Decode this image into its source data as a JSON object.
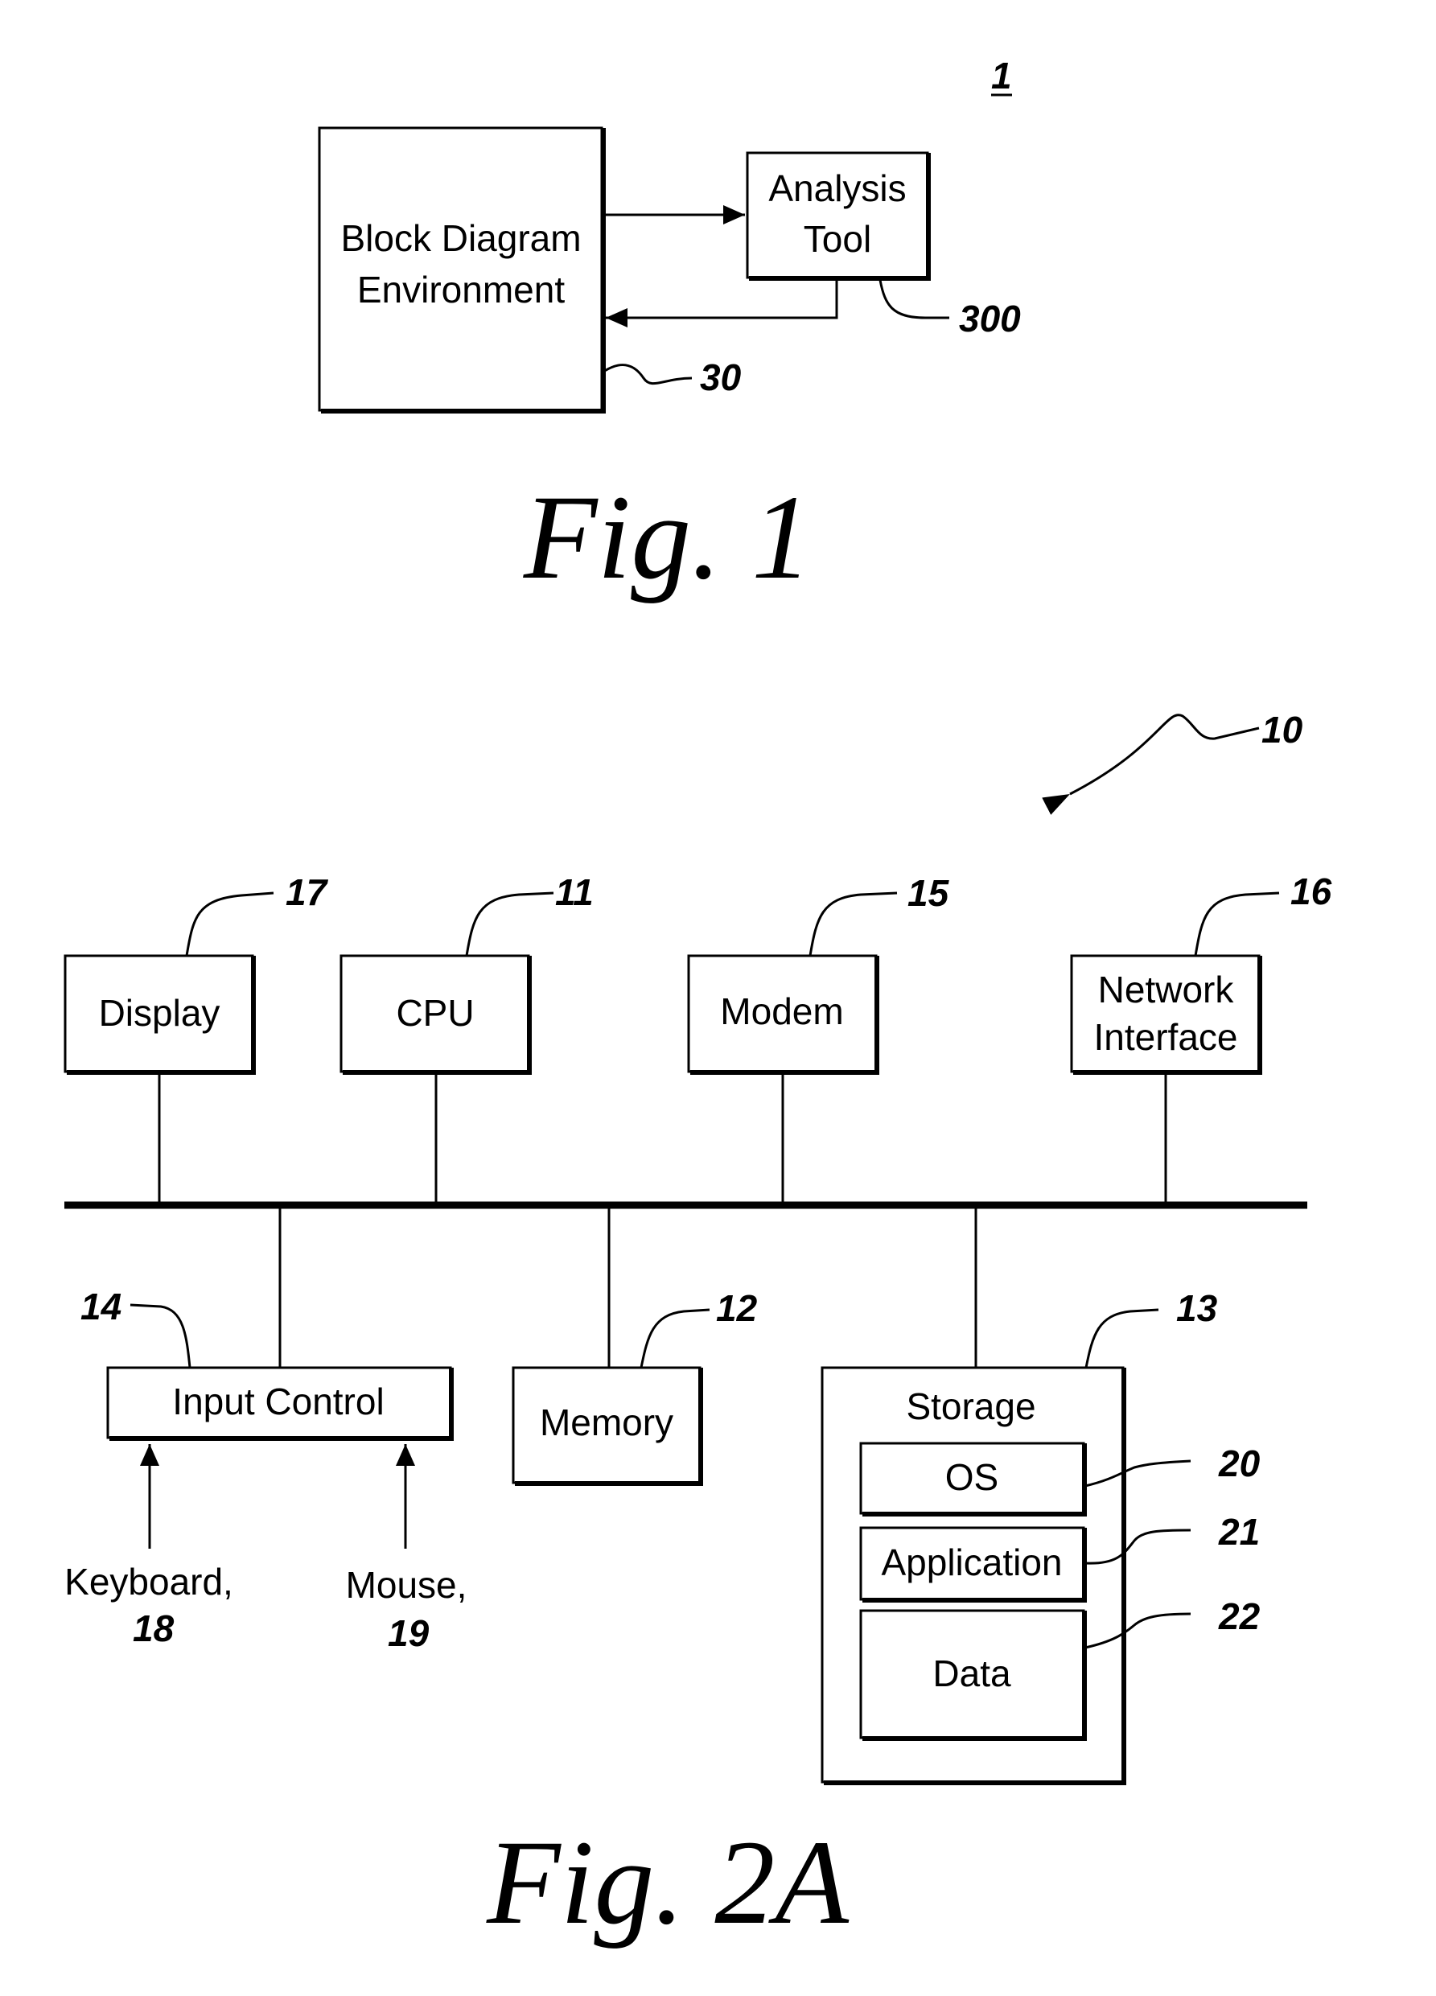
{
  "fig1": {
    "ref_number": "1",
    "caption": "Fig. 1",
    "block_diagram": {
      "line1": "Block Diagram",
      "line2": "Environment",
      "ref": "30"
    },
    "analysis_tool": {
      "line1": "Analysis",
      "line2": "Tool",
      "ref": "300"
    }
  },
  "fig2a": {
    "caption": "Fig. 2A",
    "system_ref": "10",
    "display": {
      "label": "Display",
      "ref": "17"
    },
    "cpu": {
      "label": "CPU",
      "ref": "11"
    },
    "modem": {
      "label": "Modem",
      "ref": "15"
    },
    "network": {
      "line1": "Network",
      "line2": "Interface",
      "ref": "16"
    },
    "input_control": {
      "label": "Input Control",
      "ref": "14"
    },
    "memory": {
      "label": "Memory",
      "ref": "12"
    },
    "storage": {
      "label": "Storage",
      "ref": "13"
    },
    "os": {
      "label": "OS",
      "ref": "20"
    },
    "application": {
      "label": "Application",
      "ref": "21"
    },
    "data": {
      "label": "Data",
      "ref": "22"
    },
    "keyboard": {
      "label": "Keyboard,",
      "ref": "18"
    },
    "mouse": {
      "label": "Mouse,",
      "ref": "19"
    }
  }
}
